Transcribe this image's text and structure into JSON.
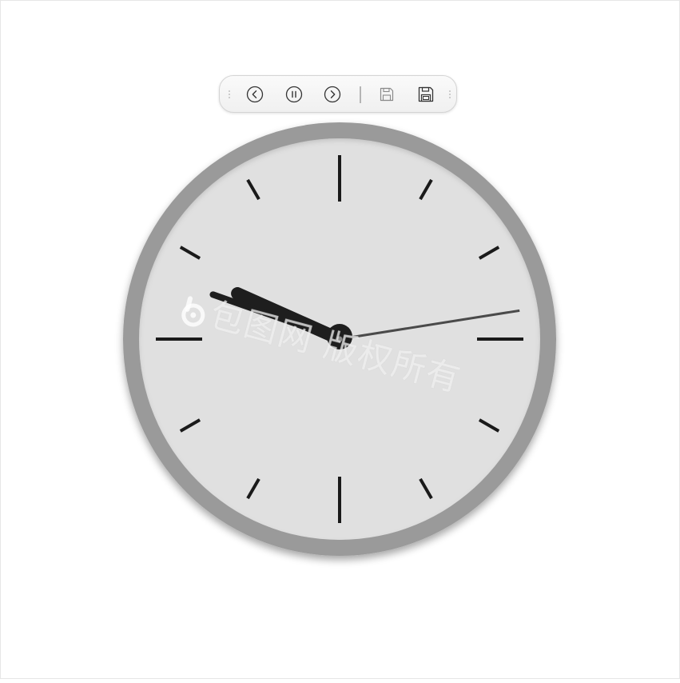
{
  "toolbar": {
    "items": [
      {
        "name": "previous",
        "icon": "chevron-left-circle-icon"
      },
      {
        "name": "pause",
        "icon": "pause-circle-icon"
      },
      {
        "name": "next",
        "icon": "chevron-right-circle-icon"
      },
      {
        "name": "save",
        "icon": "save-icon"
      },
      {
        "name": "save-as",
        "icon": "save-as-icon"
      }
    ]
  },
  "clock": {
    "time": {
      "hours": 9,
      "minutes": 48,
      "seconds": 13.5
    },
    "colors": {
      "rim": "#9a9a9a",
      "face": "#e0e0e0",
      "ticks": "#1a1a1a",
      "hands": "#1e1e1e",
      "second_hand": "#4a4a4a"
    }
  },
  "watermark": {
    "text": "包图网 版权所有"
  }
}
